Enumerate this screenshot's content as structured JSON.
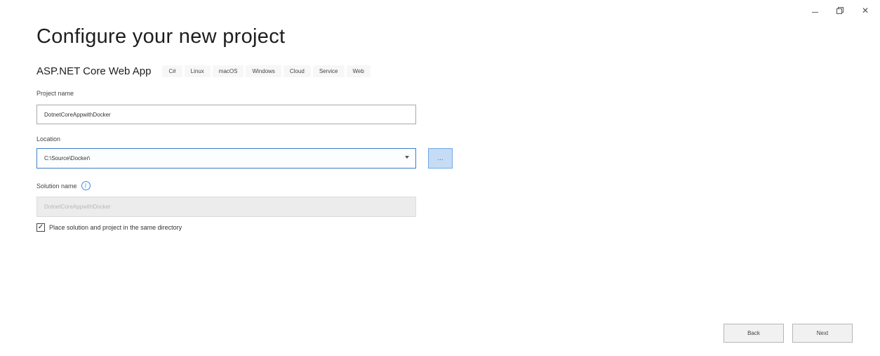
{
  "window": {
    "minimize_label": "−",
    "close_label": "✕"
  },
  "title": "Configure your new project",
  "template": {
    "name": "ASP.NET Core Web App",
    "tags": [
      "C#",
      "Linux",
      "macOS",
      "Windows",
      "Cloud",
      "Service",
      "Web"
    ]
  },
  "project_name": {
    "label": "Project name",
    "value": "DotnetCoreAppwithDocker"
  },
  "location": {
    "label": "Location",
    "value": "C:\\Source\\Docker\\",
    "browse_label": "..."
  },
  "solution_name": {
    "label": "Solution name",
    "value": "DotnetCoreAppwithDocker",
    "info_icon": "i"
  },
  "same_directory": {
    "label": "Place solution and project in the same directory",
    "check_mark": "✓"
  },
  "buttons": {
    "back": "Back",
    "next": "Next"
  },
  "colors": {
    "accent": "#3c7fc9",
    "browse_fill": "#c6dcf5"
  }
}
